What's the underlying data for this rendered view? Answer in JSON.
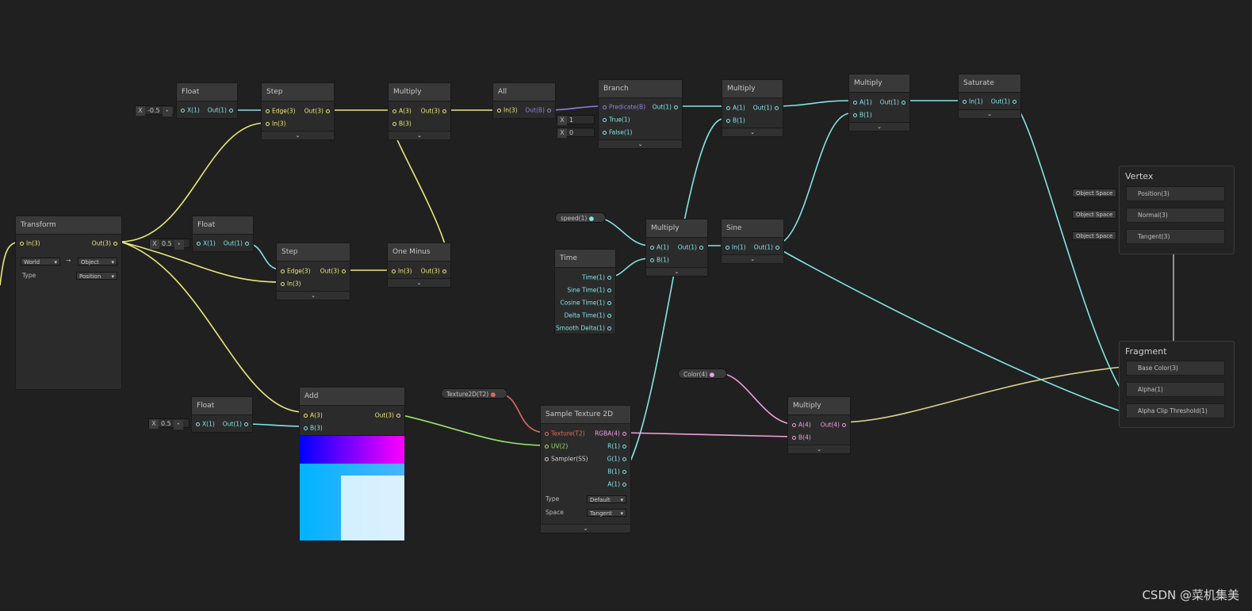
{
  "colors": {
    "background": "#202020",
    "yellow": "#e8e87a",
    "cyan": "#84e4e7",
    "pink": "#f0a0e0",
    "green": "#9ae06a",
    "purple": "#9180de",
    "red": "#e06a5c"
  },
  "transform": {
    "title": "Transform",
    "in": "In(3)",
    "out": "Out(3)",
    "from": "World",
    "to": "Object",
    "type_label": "Type",
    "type": "Position"
  },
  "float1": {
    "title": "Float",
    "x": "X",
    "value": "-0.5",
    "in": "X(1)",
    "out": "Out(1)"
  },
  "float2": {
    "title": "Float",
    "x": "X",
    "value": "0.5",
    "in": "X(1)",
    "out": "Out(1)"
  },
  "float3": {
    "title": "Float",
    "x": "X",
    "value": "0.5",
    "in": "X(1)",
    "out": "Out(1)"
  },
  "step1": {
    "title": "Step",
    "edge": "Edge(3)",
    "in": "In(3)",
    "out": "Out(3)"
  },
  "step2": {
    "title": "Step",
    "edge": "Edge(3)",
    "in": "In(3)",
    "out": "Out(3)"
  },
  "multiply1": {
    "title": "Multiply",
    "a": "A(3)",
    "b": "B(3)",
    "out": "Out(3)"
  },
  "one_minus": {
    "title": "One Minus",
    "in": "In(3)",
    "out": "Out(3)"
  },
  "all": {
    "title": "All",
    "in": "In(3)",
    "out": "Out(B)"
  },
  "branch": {
    "title": "Branch",
    "predicate": "Predicate(B)",
    "true": "True(1)",
    "false": "False(1)",
    "out": "Out(1)",
    "x": "X",
    "true_val": "1",
    "false_val": "0"
  },
  "multiply2": {
    "title": "Multiply",
    "a": "A(1)",
    "b": "B(1)",
    "out": "Out(1)"
  },
  "multiply3": {
    "title": "Multiply",
    "a": "A(1)",
    "b": "B(1)",
    "out": "Out(1)"
  },
  "saturate": {
    "title": "Saturate",
    "in": "In(1)",
    "out": "Out(1)"
  },
  "speed": {
    "label": "speed(1)"
  },
  "multiply4": {
    "title": "Multiply",
    "a": "A(1)",
    "b": "B(1)",
    "out": "Out(1)"
  },
  "sine": {
    "title": "Sine",
    "in": "In(1)",
    "out": "Out(1)"
  },
  "time": {
    "title": "Time",
    "outs": [
      "Time(1)",
      "Sine Time(1)",
      "Cosine Time(1)",
      "Delta Time(1)",
      "Smooth Delta(1)"
    ]
  },
  "add": {
    "title": "Add",
    "a": "A(3)",
    "b": "B(3)",
    "out": "Out(3)"
  },
  "texture_prop": {
    "label": "Texture2D(T2)"
  },
  "sample": {
    "title": "Sample Texture 2D",
    "ins": [
      "Texture(T2)",
      "UV(2)",
      "Sampler(SS)"
    ],
    "outs": [
      "RGBA(4)",
      "R(1)",
      "G(1)",
      "B(1)",
      "A(1)"
    ],
    "type_label": "Type",
    "type": "Default",
    "space_label": "Space",
    "space": "Tangent"
  },
  "color_prop": {
    "label": "Color(4)"
  },
  "multiply5": {
    "title": "Multiply",
    "a": "A(4)",
    "b": "B(4)",
    "out": "Out(4)"
  },
  "vertex": {
    "title": "Vertex",
    "slots": [
      "Position(3)",
      "Normal(3)",
      "Tangent(3)"
    ],
    "space": "Object Space"
  },
  "fragment": {
    "title": "Fragment",
    "slots": [
      "Base Color(3)",
      "Alpha(1)",
      "Alpha Clip Threshold(1)"
    ]
  },
  "watermark": "CSDN @菜机集美"
}
